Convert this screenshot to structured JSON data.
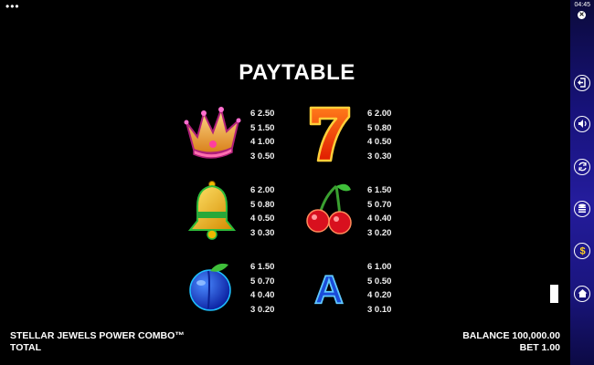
{
  "title": "PAYTABLE",
  "symbols": [
    {
      "icon": "crown-icon",
      "pays": [
        "6 2.50",
        "5 1.50",
        "4 1.00",
        "3 0.50"
      ]
    },
    {
      "icon": "seven-icon",
      "pays": [
        "6 2.00",
        "5 0.80",
        "4 0.50",
        "3 0.30"
      ]
    },
    {
      "icon": "bell-icon",
      "pays": [
        "6 2.00",
        "5 0.80",
        "4 0.50",
        "3 0.30"
      ]
    },
    {
      "icon": "cherries-icon",
      "pays": [
        "6 1.50",
        "5 0.70",
        "4 0.40",
        "3 0.20"
      ]
    },
    {
      "icon": "plum-icon",
      "pays": [
        "6 1.50",
        "5 0.70",
        "4 0.40",
        "3 0.20"
      ]
    },
    {
      "icon": "letter-a-icon",
      "letter": "A",
      "pays": [
        "6 1.00",
        "5 0.50",
        "4 0.20",
        "3 0.10"
      ]
    }
  ],
  "footer": {
    "game_name": "STELLAR JEWELS POWER COMBO™",
    "total_label": "TOTAL",
    "balance": "BALANCE 100,000.00",
    "bet": "BET 1.00"
  },
  "status": {
    "time": "04:45",
    "menu": "•••"
  },
  "sidebar": {
    "buttons": [
      "exit-icon",
      "sound-icon",
      "autoplay-icon",
      "coins-icon",
      "dollar-icon",
      "home-icon"
    ]
  },
  "colors": {
    "background": "#000000",
    "sidebar": "#1e1890",
    "text": "#ffffff"
  }
}
